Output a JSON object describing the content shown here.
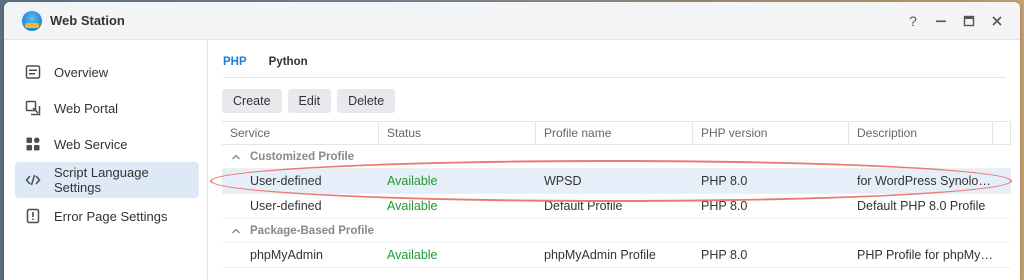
{
  "window": {
    "title": "Web Station"
  },
  "window_controls": {
    "help": "?"
  },
  "sidebar": {
    "items": [
      {
        "label": "Overview",
        "icon": "overview-icon",
        "active": false
      },
      {
        "label": "Web Portal",
        "icon": "web-portal-icon",
        "active": false
      },
      {
        "label": "Web Service",
        "icon": "web-service-icon",
        "active": false
      },
      {
        "label": "Script Language Settings",
        "icon": "code-icon",
        "active": true
      },
      {
        "label": "Error Page Settings",
        "icon": "error-page-icon",
        "active": false
      }
    ]
  },
  "tabs": [
    {
      "label": "PHP",
      "active": true
    },
    {
      "label": "Python",
      "active": false
    }
  ],
  "toolbar": {
    "create": "Create",
    "edit": "Edit",
    "delete": "Delete"
  },
  "table": {
    "columns": [
      "Service",
      "Status",
      "Profile name",
      "PHP version",
      "Description"
    ],
    "groups": [
      {
        "title": "Customized Profile",
        "rows": [
          {
            "service": "User-defined",
            "status": "Available",
            "profile": "WPSD",
            "version": "PHP 8.0",
            "description": "for WordPress Synology Deployment",
            "selected": true
          },
          {
            "service": "User-defined",
            "status": "Available",
            "profile": "Default Profile",
            "version": "PHP 8.0",
            "description": "Default PHP 8.0 Profile",
            "selected": false
          }
        ]
      },
      {
        "title": "Package-Based Profile",
        "rows": [
          {
            "service": "phpMyAdmin",
            "status": "Available",
            "profile": "phpMyAdmin Profile",
            "version": "PHP 8.0",
            "description": "PHP Profile for phpMyAdmin",
            "selected": false
          }
        ]
      }
    ]
  },
  "colors": {
    "accent": "#1a7fd6",
    "available": "#1f9a33",
    "annotation": "#ea7b74",
    "selected_row": "#e6eff9"
  }
}
